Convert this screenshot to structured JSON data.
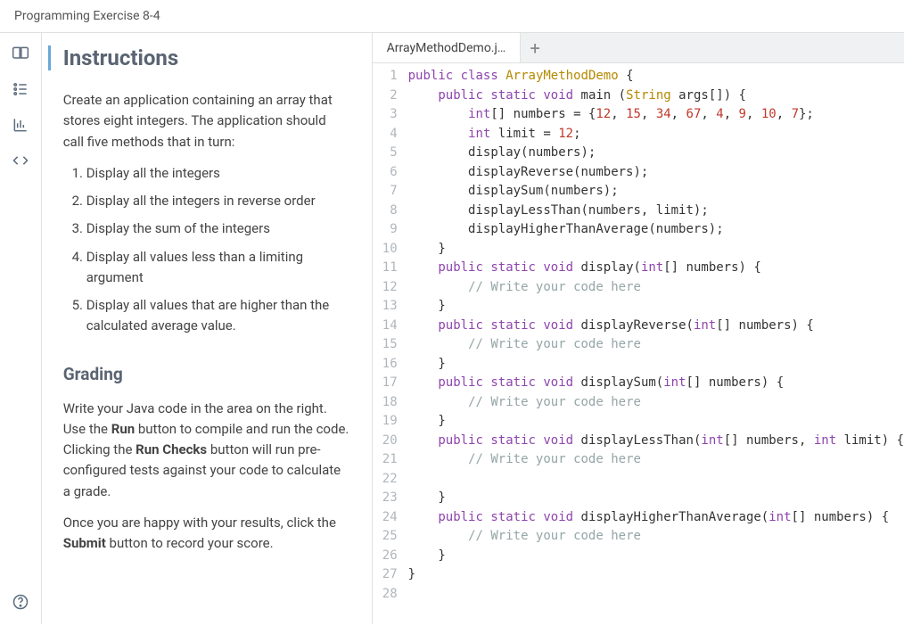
{
  "header": {
    "title": "Programming Exercise 8-4"
  },
  "sidebar": {
    "icons": [
      "book-icon",
      "list-icon",
      "chart-icon",
      "code-icon",
      "help-icon"
    ]
  },
  "instructions": {
    "title": "Instructions",
    "intro": "Create an application containing an array that stores eight integers. The application should call five methods that in turn:",
    "steps": [
      "Display all the integers",
      "Display all the integers in reverse order",
      "Display the sum of the integers",
      "Display all values less than a limiting argument",
      "Display all values that are higher than the calculated average value."
    ],
    "grading_title": "Grading",
    "grading_p1_a": "Write your Java code in the area on the right. Use the ",
    "grading_p1_run": "Run",
    "grading_p1_b": " button to compile and run the code. Clicking the ",
    "grading_p1_runchecks": "Run Checks",
    "grading_p1_c": " button will run pre-configured tests against your code to calculate a grade.",
    "grading_p2_a": "Once you are happy with your results, click the ",
    "grading_p2_submit": "Submit",
    "grading_p2_b": " button to record your score."
  },
  "editor": {
    "tab_label": "ArrayMethodDemo.j…",
    "add_tab": "+",
    "line_count": 28,
    "code": {
      "class_name": "ArrayMethodDemo",
      "numbers_init": "{12, 15, 34, 67, 4, 9, 10, 7}",
      "limit_value": "12",
      "comment": "// Write your code here",
      "methods": [
        "display",
        "displayReverse",
        "displaySum",
        "displayLessThan",
        "displayHigherThanAverage"
      ]
    }
  }
}
